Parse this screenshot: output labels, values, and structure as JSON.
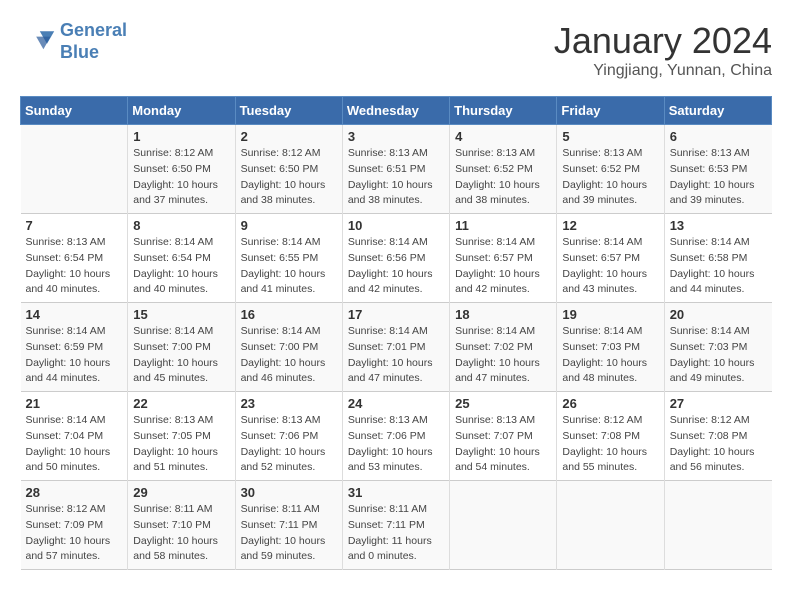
{
  "header": {
    "logo_line1": "General",
    "logo_line2": "Blue",
    "month": "January 2024",
    "location": "Yingjiang, Yunnan, China"
  },
  "days_of_week": [
    "Sunday",
    "Monday",
    "Tuesday",
    "Wednesday",
    "Thursday",
    "Friday",
    "Saturday"
  ],
  "weeks": [
    [
      {
        "day": "",
        "info": ""
      },
      {
        "day": "1",
        "info": "Sunrise: 8:12 AM\nSunset: 6:50 PM\nDaylight: 10 hours\nand 37 minutes."
      },
      {
        "day": "2",
        "info": "Sunrise: 8:12 AM\nSunset: 6:50 PM\nDaylight: 10 hours\nand 38 minutes."
      },
      {
        "day": "3",
        "info": "Sunrise: 8:13 AM\nSunset: 6:51 PM\nDaylight: 10 hours\nand 38 minutes."
      },
      {
        "day": "4",
        "info": "Sunrise: 8:13 AM\nSunset: 6:52 PM\nDaylight: 10 hours\nand 38 minutes."
      },
      {
        "day": "5",
        "info": "Sunrise: 8:13 AM\nSunset: 6:52 PM\nDaylight: 10 hours\nand 39 minutes."
      },
      {
        "day": "6",
        "info": "Sunrise: 8:13 AM\nSunset: 6:53 PM\nDaylight: 10 hours\nand 39 minutes."
      }
    ],
    [
      {
        "day": "7",
        "info": "Sunrise: 8:13 AM\nSunset: 6:54 PM\nDaylight: 10 hours\nand 40 minutes."
      },
      {
        "day": "8",
        "info": "Sunrise: 8:14 AM\nSunset: 6:54 PM\nDaylight: 10 hours\nand 40 minutes."
      },
      {
        "day": "9",
        "info": "Sunrise: 8:14 AM\nSunset: 6:55 PM\nDaylight: 10 hours\nand 41 minutes."
      },
      {
        "day": "10",
        "info": "Sunrise: 8:14 AM\nSunset: 6:56 PM\nDaylight: 10 hours\nand 42 minutes."
      },
      {
        "day": "11",
        "info": "Sunrise: 8:14 AM\nSunset: 6:57 PM\nDaylight: 10 hours\nand 42 minutes."
      },
      {
        "day": "12",
        "info": "Sunrise: 8:14 AM\nSunset: 6:57 PM\nDaylight: 10 hours\nand 43 minutes."
      },
      {
        "day": "13",
        "info": "Sunrise: 8:14 AM\nSunset: 6:58 PM\nDaylight: 10 hours\nand 44 minutes."
      }
    ],
    [
      {
        "day": "14",
        "info": "Sunrise: 8:14 AM\nSunset: 6:59 PM\nDaylight: 10 hours\nand 44 minutes."
      },
      {
        "day": "15",
        "info": "Sunrise: 8:14 AM\nSunset: 7:00 PM\nDaylight: 10 hours\nand 45 minutes."
      },
      {
        "day": "16",
        "info": "Sunrise: 8:14 AM\nSunset: 7:00 PM\nDaylight: 10 hours\nand 46 minutes."
      },
      {
        "day": "17",
        "info": "Sunrise: 8:14 AM\nSunset: 7:01 PM\nDaylight: 10 hours\nand 47 minutes."
      },
      {
        "day": "18",
        "info": "Sunrise: 8:14 AM\nSunset: 7:02 PM\nDaylight: 10 hours\nand 47 minutes."
      },
      {
        "day": "19",
        "info": "Sunrise: 8:14 AM\nSunset: 7:03 PM\nDaylight: 10 hours\nand 48 minutes."
      },
      {
        "day": "20",
        "info": "Sunrise: 8:14 AM\nSunset: 7:03 PM\nDaylight: 10 hours\nand 49 minutes."
      }
    ],
    [
      {
        "day": "21",
        "info": "Sunrise: 8:14 AM\nSunset: 7:04 PM\nDaylight: 10 hours\nand 50 minutes."
      },
      {
        "day": "22",
        "info": "Sunrise: 8:13 AM\nSunset: 7:05 PM\nDaylight: 10 hours\nand 51 minutes."
      },
      {
        "day": "23",
        "info": "Sunrise: 8:13 AM\nSunset: 7:06 PM\nDaylight: 10 hours\nand 52 minutes."
      },
      {
        "day": "24",
        "info": "Sunrise: 8:13 AM\nSunset: 7:06 PM\nDaylight: 10 hours\nand 53 minutes."
      },
      {
        "day": "25",
        "info": "Sunrise: 8:13 AM\nSunset: 7:07 PM\nDaylight: 10 hours\nand 54 minutes."
      },
      {
        "day": "26",
        "info": "Sunrise: 8:12 AM\nSunset: 7:08 PM\nDaylight: 10 hours\nand 55 minutes."
      },
      {
        "day": "27",
        "info": "Sunrise: 8:12 AM\nSunset: 7:08 PM\nDaylight: 10 hours\nand 56 minutes."
      }
    ],
    [
      {
        "day": "28",
        "info": "Sunrise: 8:12 AM\nSunset: 7:09 PM\nDaylight: 10 hours\nand 57 minutes."
      },
      {
        "day": "29",
        "info": "Sunrise: 8:11 AM\nSunset: 7:10 PM\nDaylight: 10 hours\nand 58 minutes."
      },
      {
        "day": "30",
        "info": "Sunrise: 8:11 AM\nSunset: 7:11 PM\nDaylight: 10 hours\nand 59 minutes."
      },
      {
        "day": "31",
        "info": "Sunrise: 8:11 AM\nSunset: 7:11 PM\nDaylight: 11 hours\nand 0 minutes."
      },
      {
        "day": "",
        "info": ""
      },
      {
        "day": "",
        "info": ""
      },
      {
        "day": "",
        "info": ""
      }
    ]
  ]
}
